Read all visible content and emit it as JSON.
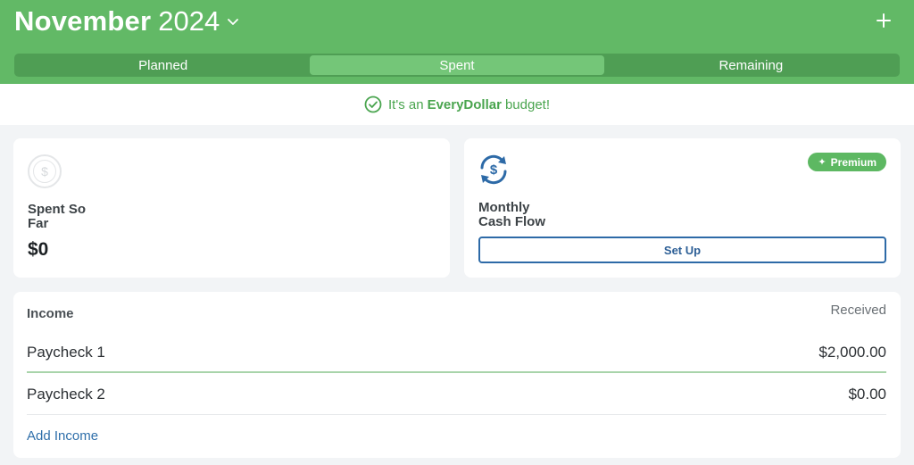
{
  "header": {
    "month": "November",
    "year": "2024",
    "tabs": [
      {
        "label": "Planned",
        "active": false
      },
      {
        "label": "Spent",
        "active": true
      },
      {
        "label": "Remaining",
        "active": false
      }
    ]
  },
  "banner": {
    "prefix": "It's an",
    "brand": "EveryDollar",
    "suffix": "budget!",
    "icon": "check-circle-icon"
  },
  "spent_card": {
    "label": "Spent So Far",
    "amount": "$0",
    "icon": "dollar-coin-icon",
    "icon_glyph": "$"
  },
  "cash_card": {
    "badge_star": "✦",
    "badge": "Premium",
    "label": "Monthly Cash Flow",
    "button": "Set Up",
    "icon": "cash-flow-cycle-icon"
  },
  "income": {
    "heading": "Income",
    "column": "Received",
    "rows": [
      {
        "name": "Paycheck 1",
        "amount": "$2,000.00"
      },
      {
        "name": "Paycheck 2",
        "amount": "$0.00"
      }
    ],
    "add_label": "Add Income"
  },
  "colors": {
    "header_green": "#62b966",
    "segment_green": "#4f9e54",
    "segment_active": "#74c678",
    "brand_green": "#4aa54f",
    "link_blue": "#2f6faa",
    "button_blue": "#2d6aa7"
  }
}
